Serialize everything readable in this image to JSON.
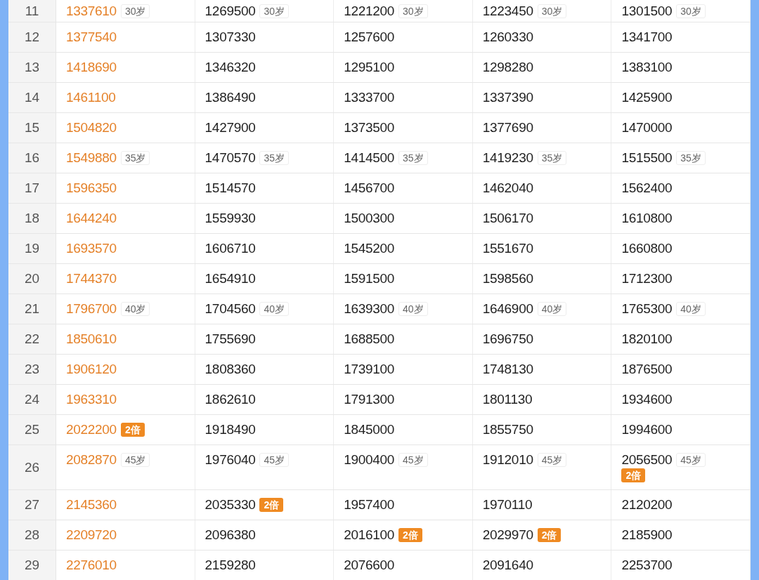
{
  "table": {
    "rows": [
      {
        "number": "11",
        "cells": [
          {
            "value": "1337610",
            "tags": [
              {
                "kind": "age",
                "text": "30岁"
              }
            ]
          },
          {
            "value": "1269500",
            "tags": [
              {
                "kind": "age",
                "text": "30岁"
              }
            ]
          },
          {
            "value": "1221200",
            "tags": [
              {
                "kind": "age",
                "text": "30岁"
              }
            ]
          },
          {
            "value": "1223450",
            "tags": [
              {
                "kind": "age",
                "text": "30岁"
              }
            ]
          },
          {
            "value": "1301500",
            "tags": [
              {
                "kind": "age",
                "text": "30岁"
              }
            ]
          }
        ]
      },
      {
        "number": "12",
        "cells": [
          {
            "value": "1377540"
          },
          {
            "value": "1307330"
          },
          {
            "value": "1257600"
          },
          {
            "value": "1260330"
          },
          {
            "value": "1341700"
          }
        ]
      },
      {
        "number": "13",
        "cells": [
          {
            "value": "1418690"
          },
          {
            "value": "1346320"
          },
          {
            "value": "1295100"
          },
          {
            "value": "1298280"
          },
          {
            "value": "1383100"
          }
        ]
      },
      {
        "number": "14",
        "cells": [
          {
            "value": "1461100"
          },
          {
            "value": "1386490"
          },
          {
            "value": "1333700"
          },
          {
            "value": "1337390"
          },
          {
            "value": "1425900"
          }
        ]
      },
      {
        "number": "15",
        "cells": [
          {
            "value": "1504820"
          },
          {
            "value": "1427900"
          },
          {
            "value": "1373500"
          },
          {
            "value": "1377690"
          },
          {
            "value": "1470000"
          }
        ]
      },
      {
        "number": "16",
        "cells": [
          {
            "value": "1549880",
            "tags": [
              {
                "kind": "age",
                "text": "35岁"
              }
            ]
          },
          {
            "value": "1470570",
            "tags": [
              {
                "kind": "age",
                "text": "35岁"
              }
            ]
          },
          {
            "value": "1414500",
            "tags": [
              {
                "kind": "age",
                "text": "35岁"
              }
            ]
          },
          {
            "value": "1419230",
            "tags": [
              {
                "kind": "age",
                "text": "35岁"
              }
            ]
          },
          {
            "value": "1515500",
            "tags": [
              {
                "kind": "age",
                "text": "35岁"
              }
            ]
          }
        ]
      },
      {
        "number": "17",
        "cells": [
          {
            "value": "1596350"
          },
          {
            "value": "1514570"
          },
          {
            "value": "1456700"
          },
          {
            "value": "1462040"
          },
          {
            "value": "1562400"
          }
        ]
      },
      {
        "number": "18",
        "cells": [
          {
            "value": "1644240"
          },
          {
            "value": "1559930"
          },
          {
            "value": "1500300"
          },
          {
            "value": "1506170"
          },
          {
            "value": "1610800"
          }
        ]
      },
      {
        "number": "19",
        "cells": [
          {
            "value": "1693570"
          },
          {
            "value": "1606710"
          },
          {
            "value": "1545200"
          },
          {
            "value": "1551670"
          },
          {
            "value": "1660800"
          }
        ]
      },
      {
        "number": "20",
        "cells": [
          {
            "value": "1744370"
          },
          {
            "value": "1654910"
          },
          {
            "value": "1591500"
          },
          {
            "value": "1598560"
          },
          {
            "value": "1712300"
          }
        ]
      },
      {
        "number": "21",
        "cells": [
          {
            "value": "1796700",
            "tags": [
              {
                "kind": "age",
                "text": "40岁"
              }
            ]
          },
          {
            "value": "1704560",
            "tags": [
              {
                "kind": "age",
                "text": "40岁"
              }
            ]
          },
          {
            "value": "1639300",
            "tags": [
              {
                "kind": "age",
                "text": "40岁"
              }
            ]
          },
          {
            "value": "1646900",
            "tags": [
              {
                "kind": "age",
                "text": "40岁"
              }
            ]
          },
          {
            "value": "1765300",
            "tags": [
              {
                "kind": "age",
                "text": "40岁"
              }
            ]
          }
        ]
      },
      {
        "number": "22",
        "cells": [
          {
            "value": "1850610"
          },
          {
            "value": "1755690"
          },
          {
            "value": "1688500"
          },
          {
            "value": "1696750"
          },
          {
            "value": "1820100"
          }
        ]
      },
      {
        "number": "23",
        "cells": [
          {
            "value": "1906120"
          },
          {
            "value": "1808360"
          },
          {
            "value": "1739100"
          },
          {
            "value": "1748130"
          },
          {
            "value": "1876500"
          }
        ]
      },
      {
        "number": "24",
        "cells": [
          {
            "value": "1963310"
          },
          {
            "value": "1862610"
          },
          {
            "value": "1791300"
          },
          {
            "value": "1801130"
          },
          {
            "value": "1934600"
          }
        ]
      },
      {
        "number": "25",
        "cells": [
          {
            "value": "2022200",
            "tags": [
              {
                "kind": "double",
                "text": "2倍"
              }
            ]
          },
          {
            "value": "1918490"
          },
          {
            "value": "1845000"
          },
          {
            "value": "1855750"
          },
          {
            "value": "1994600"
          }
        ]
      },
      {
        "number": "26",
        "cells": [
          {
            "value": "2082870",
            "tags": [
              {
                "kind": "age",
                "text": "45岁"
              }
            ]
          },
          {
            "value": "1976040",
            "tags": [
              {
                "kind": "age",
                "text": "45岁"
              }
            ]
          },
          {
            "value": "1900400",
            "tags": [
              {
                "kind": "age",
                "text": "45岁"
              }
            ]
          },
          {
            "value": "1912010",
            "tags": [
              {
                "kind": "age",
                "text": "45岁"
              }
            ]
          },
          {
            "value": "2056500",
            "tags": [
              {
                "kind": "age",
                "text": "45岁"
              },
              {
                "kind": "double",
                "text": "2倍"
              }
            ]
          }
        ]
      },
      {
        "number": "27",
        "cells": [
          {
            "value": "2145360"
          },
          {
            "value": "2035330",
            "tags": [
              {
                "kind": "double",
                "text": "2倍"
              }
            ]
          },
          {
            "value": "1957400"
          },
          {
            "value": "1970110"
          },
          {
            "value": "2120200"
          }
        ]
      },
      {
        "number": "28",
        "cells": [
          {
            "value": "2209720"
          },
          {
            "value": "2096380"
          },
          {
            "value": "2016100",
            "tags": [
              {
                "kind": "double",
                "text": "2倍"
              }
            ]
          },
          {
            "value": "2029970",
            "tags": [
              {
                "kind": "double",
                "text": "2倍"
              }
            ]
          },
          {
            "value": "2185900"
          }
        ]
      },
      {
        "number": "29",
        "cells": [
          {
            "value": "2276010"
          },
          {
            "value": "2159280"
          },
          {
            "value": "2076600"
          },
          {
            "value": "2091640"
          },
          {
            "value": "2253700"
          }
        ]
      }
    ]
  }
}
